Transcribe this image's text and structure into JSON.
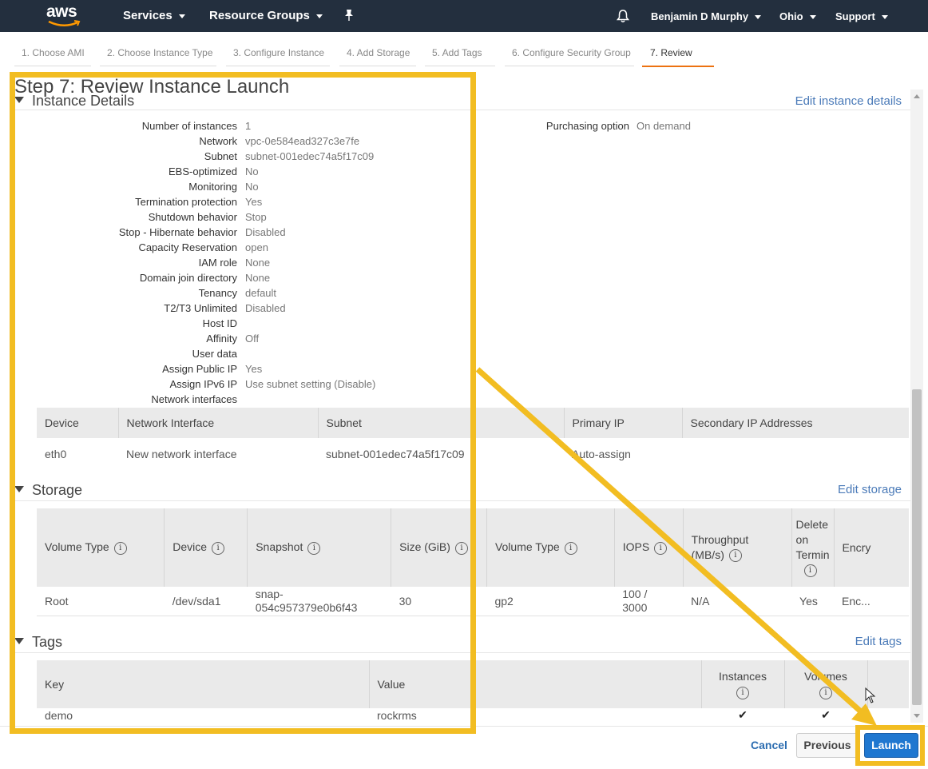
{
  "nav": {
    "logo": "aws",
    "services": "Services",
    "resource_groups": "Resource Groups",
    "user": "Benjamin D Murphy",
    "region": "Ohio",
    "support": "Support"
  },
  "tabs": [
    "1. Choose AMI",
    "2. Choose Instance Type",
    "3. Configure Instance",
    "4. Add Storage",
    "5. Add Tags",
    "6. Configure Security Group",
    "7. Review"
  ],
  "page_title": "Step 7: Review Instance Launch",
  "instance_details": {
    "heading": "Instance Details",
    "edit": "Edit instance details",
    "rows": [
      {
        "label": "Number of instances",
        "value": "1"
      },
      {
        "label": "Network",
        "value": "vpc-0e584ead327c3e7fe"
      },
      {
        "label": "Subnet",
        "value": "subnet-001edec74a5f17c09"
      },
      {
        "label": "EBS-optimized",
        "value": "No"
      },
      {
        "label": "Monitoring",
        "value": "No"
      },
      {
        "label": "Termination protection",
        "value": "Yes"
      },
      {
        "label": "Shutdown behavior",
        "value": "Stop"
      },
      {
        "label": "Stop - Hibernate behavior",
        "value": "Disabled"
      },
      {
        "label": "Capacity Reservation",
        "value": "open"
      },
      {
        "label": "IAM role",
        "value": "None"
      },
      {
        "label": "Domain join directory",
        "value": "None"
      },
      {
        "label": "Tenancy",
        "value": "default"
      },
      {
        "label": "T2/T3 Unlimited",
        "value": "Disabled"
      },
      {
        "label": "Host ID",
        "value": ""
      },
      {
        "label": "Affinity",
        "value": "Off"
      },
      {
        "label": "User data",
        "value": ""
      },
      {
        "label": "Assign Public IP",
        "value": "Yes"
      },
      {
        "label": "Assign IPv6 IP",
        "value": "Use subnet setting (Disable)"
      },
      {
        "label": "Network interfaces",
        "value": ""
      }
    ],
    "purchasing_label": "Purchasing option",
    "purchasing_value": "On demand"
  },
  "network_table": {
    "headers": [
      "Device",
      "Network Interface",
      "Subnet",
      "Primary IP",
      "Secondary IP Addresses"
    ],
    "row": [
      "eth0",
      "New network interface",
      "subnet-001edec74a5f17c09",
      "Auto-assign",
      ""
    ]
  },
  "storage": {
    "heading": "Storage",
    "edit": "Edit storage",
    "headers": [
      "Volume Type",
      "Device",
      "Snapshot",
      "Size (GiB)",
      "Volume Type",
      "IOPS",
      "Throughput (MB/s)",
      "Delete on Termin",
      "Encry"
    ],
    "row": [
      "Root",
      "/dev/sda1",
      "snap-054c957379e0b6f43",
      "30",
      "gp2",
      "100 / 3000",
      "N/A",
      "Yes",
      "Enc..."
    ]
  },
  "tags": {
    "heading": "Tags",
    "edit": "Edit tags",
    "headers": [
      "Key",
      "Value",
      "Instances",
      "Volumes"
    ],
    "row": [
      "demo",
      "rockrms",
      "✔",
      "✔"
    ]
  },
  "footer": {
    "cancel": "Cancel",
    "previous": "Previous",
    "launch": "Launch"
  },
  "colors": {
    "nav_bg": "#232f3e",
    "accent_orange": "#ec7211",
    "link_blue": "#4a7ab8",
    "launch_blue": "#1f77d0",
    "highlight_yellow": "#f2bd22"
  }
}
